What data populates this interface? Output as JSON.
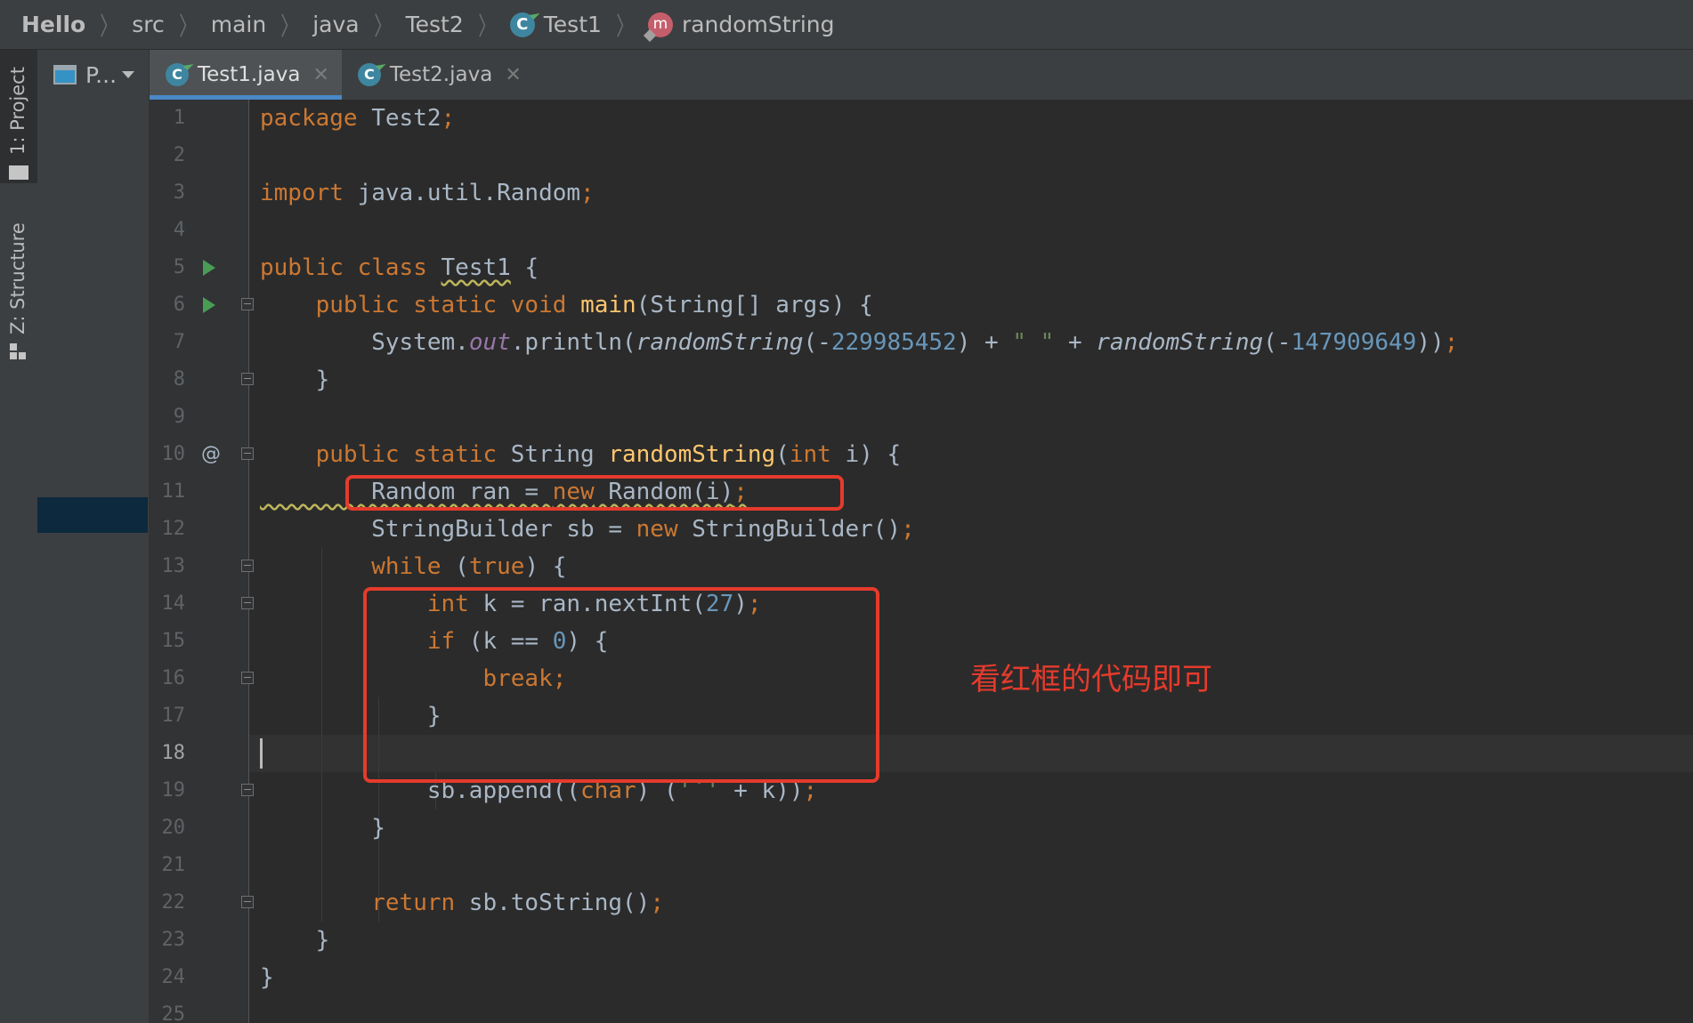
{
  "breadcrumb": {
    "items": [
      "Hello",
      "src",
      "main",
      "java",
      "Test2",
      "Test1",
      "randomString"
    ],
    "class_badge": "C",
    "method_badge": "m"
  },
  "toolwindows": {
    "project_label": "1: Project",
    "structure_label": "Z: Structure"
  },
  "project_panel": {
    "title": "P..."
  },
  "tabs": [
    {
      "label": "Test1.java",
      "active": true
    },
    {
      "label": "Test2.java",
      "active": false
    }
  ],
  "editor": {
    "current_line": 18,
    "line_numbers": [
      "1",
      "2",
      "3",
      "4",
      "5",
      "6",
      "7",
      "8",
      "9",
      "10",
      "11",
      "12",
      "13",
      "14",
      "15",
      "16",
      "17",
      "18",
      "19",
      "20",
      "21",
      "22",
      "23",
      "24",
      "25"
    ],
    "annotation": "看红框的代码即可",
    "lines": [
      "package Test2;",
      "",
      "import java.util.Random;",
      "",
      "public class Test1 {",
      "    public static void main(String[] args) {",
      "        System.out.println(randomString(-229985452) + \" \" + randomString(-147909649));",
      "    }",
      "",
      "    public static String randomString(int i) {",
      "        Random ran = new Random(i);",
      "        StringBuilder sb = new StringBuilder();",
      "        while (true) {",
      "            int k = ran.nextInt(27);",
      "            if (k == 0) {",
      "                break;",
      "            }",
      "",
      "            sb.append((char) ('`' + k));",
      "        }",
      "",
      "        return sb.toString();",
      "    }",
      "}",
      ""
    ]
  },
  "colors": {
    "keyword": "#cc7832",
    "number": "#6897bb",
    "string": "#6a8759",
    "method_decl": "#ffc66d",
    "static_field": "#9876aa",
    "annotation_red": "#e53b2c",
    "tab_accent": "#4a88c7"
  }
}
